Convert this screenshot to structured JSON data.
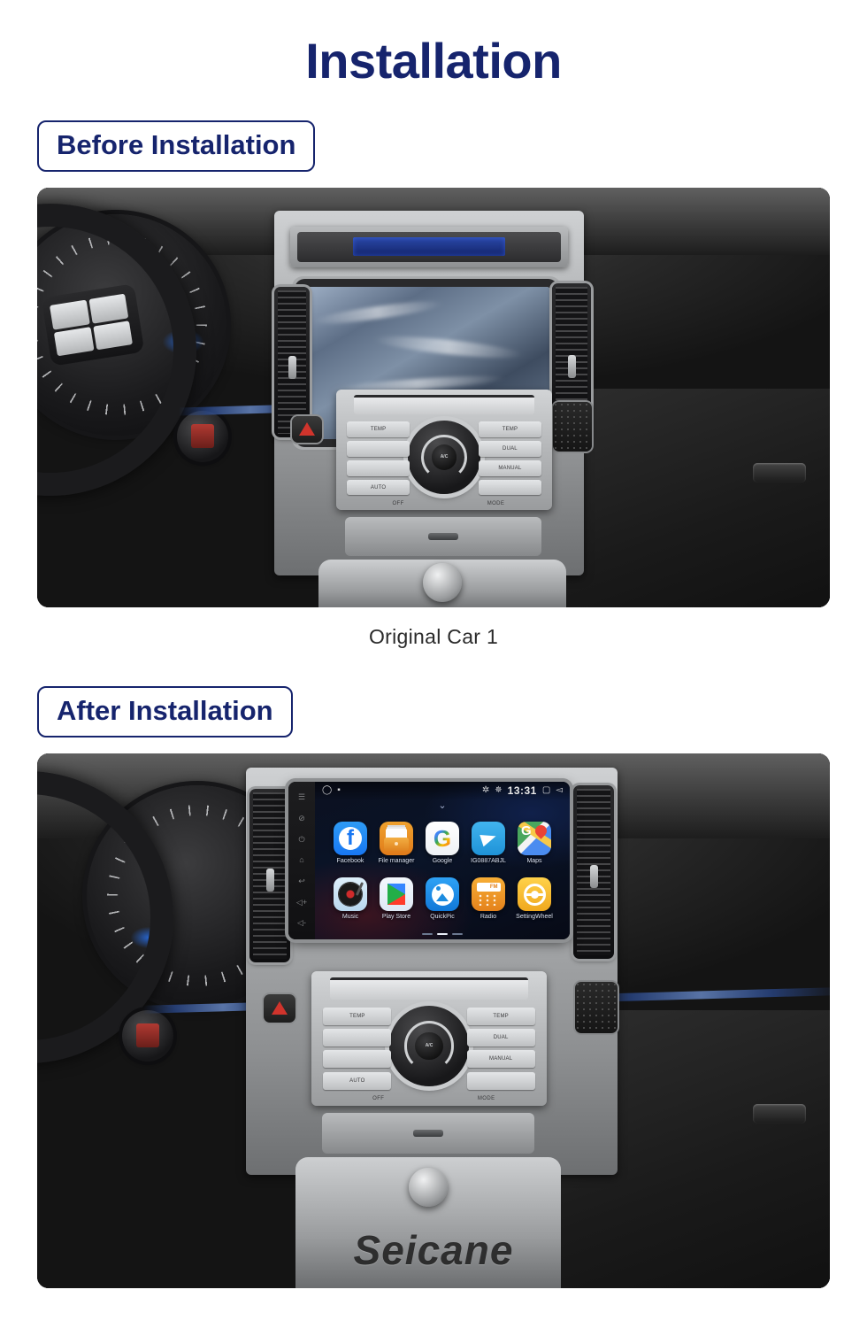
{
  "page": {
    "title": "Installation",
    "brand_watermark": "Seicane",
    "accent_color": "#16246d",
    "background_color": "#ffffff"
  },
  "sections": [
    {
      "badge_label": "Before Installation",
      "caption": "Original Car  1",
      "photo_alt": "Original car dashboard with factory 2-DIN radio, climate panel and steering wheel"
    },
    {
      "badge_label": "After Installation",
      "caption": "",
      "photo_alt": "Car dashboard after installing the Android touchscreen head unit"
    }
  ],
  "head_unit": {
    "status_bar": {
      "time": "13:31",
      "left_icons": [
        "circle-icon",
        "sdcard-icon"
      ],
      "right_icons": [
        "bluetooth-icon",
        "bluetooth-connected-icon"
      ],
      "nav_icons": [
        "recents-icon",
        "back-icon"
      ]
    },
    "pull_down_hint": "chevron-down-icon",
    "apps_row1": [
      {
        "label": "Facebook",
        "icon": "facebook-icon"
      },
      {
        "label": "File manager",
        "icon": "file-manager-icon"
      },
      {
        "label": "Google",
        "icon": "google-icon"
      },
      {
        "label": "IG0887ABJL",
        "icon": "telegram-icon"
      },
      {
        "label": "Maps",
        "icon": "google-maps-icon"
      }
    ],
    "apps_row2": [
      {
        "label": "Music",
        "icon": "music-icon"
      },
      {
        "label": "Play Store",
        "icon": "play-store-icon"
      },
      {
        "label": "QuickPic",
        "icon": "quickpic-icon"
      },
      {
        "label": "Radio",
        "icon": "radio-icon"
      },
      {
        "label": "SettingWheel",
        "icon": "steering-wheel-icon"
      }
    ],
    "page_dots": {
      "count": 3,
      "active_index": 1
    },
    "side_buttons": [
      "menu-icon",
      "mute-icon",
      "power-icon",
      "home-icon",
      "back-icon",
      "volume-up-icon",
      "volume-down-icon"
    ]
  },
  "climate_panel": {
    "left_labels": [
      "TEMP",
      "AUTO"
    ],
    "right_labels": [
      "TEMP",
      "DUAL",
      "MANUAL"
    ],
    "bottom_labels": [
      "OFF",
      "MODE"
    ],
    "dial_label": "A/C"
  }
}
